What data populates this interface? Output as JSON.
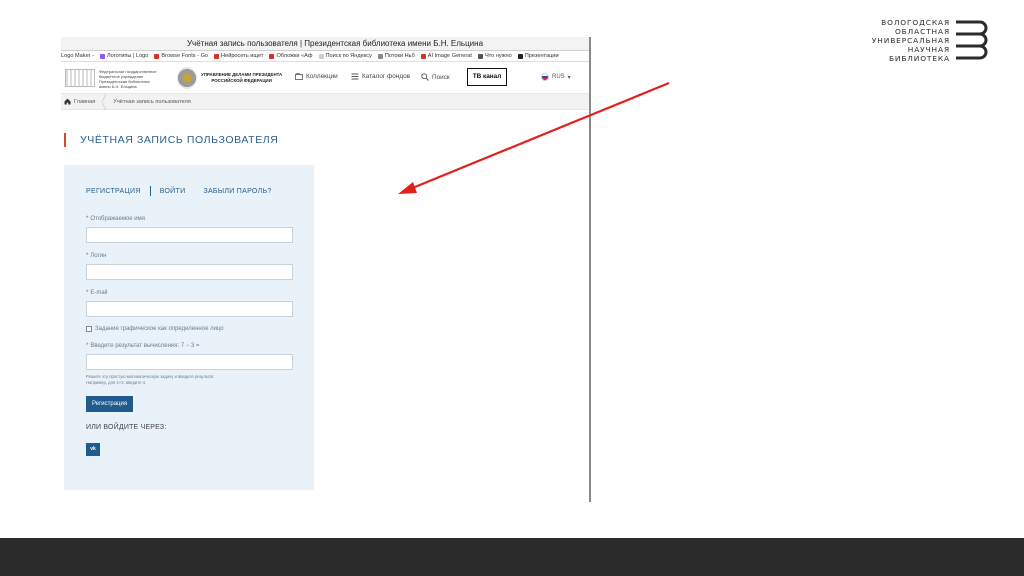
{
  "logo": {
    "lines": [
      "ВОЛОГОДСКАЯ",
      "ОБЛАСТНАЯ",
      "УНИВЕРСАЛЬНАЯ",
      "НАУЧНАЯ",
      "БИБЛИОТЕКА"
    ]
  },
  "browser": {
    "window_title": "Учётная запись пользователя | Президентская библиотека имени Б.Н. Ельцина",
    "bookmarks": [
      {
        "label": "Logo Maker -",
        "color": "#444444"
      },
      {
        "label": "Логотипы | Logo",
        "color": "#8b5cf6"
      },
      {
        "label": "Browse Fonts - Go",
        "color": "#d93025"
      },
      {
        "label": "Нейросеть ищет",
        "color": "#d93025"
      },
      {
        "label": "Обложки «Аф",
        "color": "#d93025"
      },
      {
        "label": "Поиск по Яндексу",
        "color": "#cccccc"
      },
      {
        "label": "Потоки Ньб",
        "color": "#888888"
      },
      {
        "label": "AI Image Generat",
        "color": "#d93025"
      },
      {
        "label": "Что нужно",
        "color": "#555555"
      },
      {
        "label": "Презентации",
        "color": "#222222"
      }
    ]
  },
  "site_header": {
    "left_org_text": [
      "Федеральное государственное",
      "бюджетное учреждение",
      "Президентская библиотека",
      "имени Б.Н. Ельцина"
    ],
    "right_org_text": [
      "УПРАВЛЕНИЕ ДЕЛАМИ ПРЕЗИДЕНТА",
      "РОССИЙСКОЙ ФЕДЕРАЦИИ"
    ],
    "nav": [
      {
        "label": "Коллекции",
        "icon": "collections-icon"
      },
      {
        "label": "Каталог фондов",
        "icon": "catalog-icon"
      },
      {
        "label": "Поиск",
        "icon": "search-icon"
      }
    ],
    "tv_button": "ТВ канал",
    "language": "RUS"
  },
  "breadcrumbs": [
    {
      "label": "Главная"
    },
    {
      "label": "Учётная запись пользователя"
    }
  ],
  "page": {
    "heading": "УЧЁТНАЯ ЗАПИСЬ ПОЛЬЗОВАТЕЛЯ"
  },
  "form": {
    "tabs": [
      "РЕГИСТРАЦИЯ",
      "ВОЙТИ",
      "ЗАБЫЛИ ПАРОЛЬ?"
    ],
    "fields": [
      {
        "label": "Отображаемое имя",
        "value": ""
      },
      {
        "label": "Логин",
        "value": ""
      },
      {
        "label": "E-mail",
        "value": ""
      },
      {
        "label": "Введите результат вычисления: 7 − 3 =",
        "value": ""
      }
    ],
    "checkbox_label": "Задание графическое как определенное лицо",
    "hint_lines": [
      "Решите эту простую математическую задачу и введите результат.",
      "Например, для 1+3, введите 4."
    ],
    "submit_label": "Регистрация",
    "alt_login_label": "ИЛИ ВОЙДИТЕ ЧЕРЕЗ:",
    "vk_label": "vk"
  },
  "annotation": {
    "arrow_color": "#e3201b"
  }
}
